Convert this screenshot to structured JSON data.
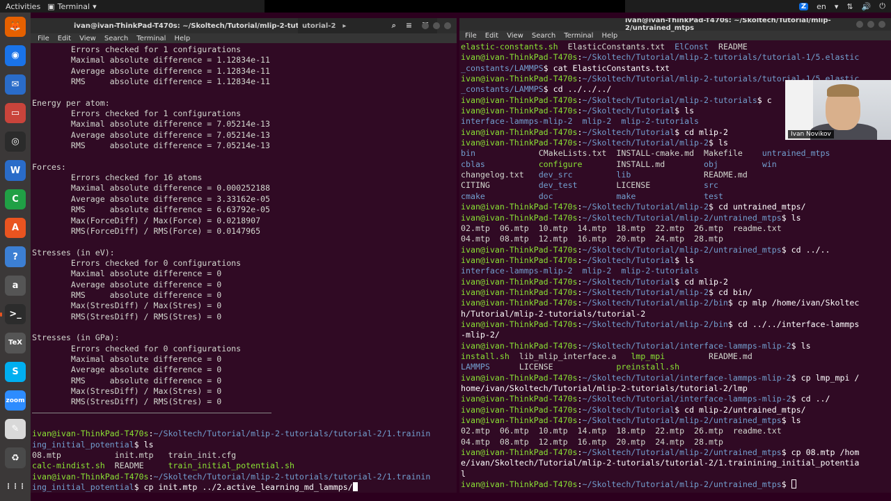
{
  "topbar": {
    "activities": "Activities",
    "app_name": "Terminal",
    "app_menu_arrow": "▾",
    "zoom_badge": "Z",
    "language": "en",
    "indicators": [
      "▾",
      "⇅",
      "🔊",
      "⏻"
    ]
  },
  "dock": {
    "items": [
      {
        "name": "firefox-icon",
        "glyph": "🦊",
        "color": "#e66000"
      },
      {
        "name": "chrome-icon",
        "glyph": "◉",
        "color": "#1a73e8"
      },
      {
        "name": "thunderbird-icon",
        "glyph": "✉",
        "color": "#2a6cc9"
      },
      {
        "name": "files-icon",
        "glyph": "▭",
        "color": "#c9443b"
      },
      {
        "name": "rhythmbox-icon",
        "glyph": "◎",
        "color": "#2b2b2b"
      },
      {
        "name": "writer-icon",
        "glyph": "W",
        "color": "#2a6cc9"
      },
      {
        "name": "calc-icon",
        "glyph": "C",
        "color": "#20a045"
      },
      {
        "name": "software-icon",
        "glyph": "A",
        "color": "#e95420"
      },
      {
        "name": "help-icon",
        "glyph": "?",
        "color": "#3c7fd3"
      },
      {
        "name": "amazon-icon",
        "glyph": "a",
        "color": "#555555"
      },
      {
        "name": "terminal-icon",
        "glyph": ">_",
        "color": "#2c2c2c"
      },
      {
        "name": "texmaker-icon",
        "glyph": "TeX",
        "color": "#555555"
      },
      {
        "name": "skype-icon",
        "glyph": "S",
        "color": "#00aff0"
      },
      {
        "name": "zoom-icon",
        "glyph": "zoom",
        "color": "#2d8cff"
      },
      {
        "name": "text-editor-icon",
        "glyph": "✎",
        "color": "#d9d9d9"
      },
      {
        "name": "trash-icon",
        "glyph": "♻",
        "color": "#4a4a4a"
      },
      {
        "name": "show-apps-icon",
        "glyph": "⋮⋮⋮",
        "color": "#3b3838"
      }
    ]
  },
  "left_window": {
    "title": "ivan@ivan-ThinkPad-T470s: ~/Skoltech/Tutorial/mlip-2-tut",
    "tab_fragment": "utorial-2",
    "menu": [
      "File",
      "Edit",
      "View",
      "Search",
      "Terminal",
      "Help"
    ],
    "lines": [
      [
        [
          "c-o",
          "        Errors checked for 1 configurations"
        ]
      ],
      [
        [
          "c-o",
          "        Maximal absolute difference = 1.12834e-11"
        ]
      ],
      [
        [
          "c-o",
          "        Average absolute difference = 1.12834e-11"
        ]
      ],
      [
        [
          "c-o",
          "        RMS     absolute difference = 1.12834e-11"
        ]
      ],
      [
        [
          "c-o",
          ""
        ]
      ],
      [
        [
          "c-o",
          "Energy per atom:"
        ]
      ],
      [
        [
          "c-o",
          "        Errors checked for 1 configurations"
        ]
      ],
      [
        [
          "c-o",
          "        Maximal absolute difference = 7.05214e-13"
        ]
      ],
      [
        [
          "c-o",
          "        Average absolute difference = 7.05214e-13"
        ]
      ],
      [
        [
          "c-o",
          "        RMS     absolute difference = 7.05214e-13"
        ]
      ],
      [
        [
          "c-o",
          ""
        ]
      ],
      [
        [
          "c-o",
          "Forces:"
        ]
      ],
      [
        [
          "c-o",
          "        Errors checked for 16 atoms"
        ]
      ],
      [
        [
          "c-o",
          "        Maximal absolute difference = 0.000252188"
        ]
      ],
      [
        [
          "c-o",
          "        Average absolute difference = 3.33162e-05"
        ]
      ],
      [
        [
          "c-o",
          "        RMS     absolute difference = 6.63792e-05"
        ]
      ],
      [
        [
          "c-o",
          "        Max(ForceDiff) / Max(Force) = 0.0218907"
        ]
      ],
      [
        [
          "c-o",
          "        RMS(ForceDiff) / RMS(Force) = 0.0147965"
        ]
      ],
      [
        [
          "c-o",
          ""
        ]
      ],
      [
        [
          "c-o",
          "Stresses (in eV):"
        ]
      ],
      [
        [
          "c-o",
          "        Errors checked for 0 configurations"
        ]
      ],
      [
        [
          "c-o",
          "        Maximal absolute difference = 0"
        ]
      ],
      [
        [
          "c-o",
          "        Average absolute difference = 0"
        ]
      ],
      [
        [
          "c-o",
          "        RMS     absolute difference = 0"
        ]
      ],
      [
        [
          "c-o",
          "        Max(StresDiff) / Max(Stres) = 0"
        ]
      ],
      [
        [
          "c-o",
          "        RMS(StresDiff) / RMS(Stres) = 0"
        ]
      ],
      [
        [
          "c-o",
          ""
        ]
      ],
      [
        [
          "c-o",
          "Stresses (in GPa):"
        ]
      ],
      [
        [
          "c-o",
          "        Errors checked for 0 configurations"
        ]
      ],
      [
        [
          "c-o",
          "        Maximal absolute difference = 0"
        ]
      ],
      [
        [
          "c-o",
          "        Average absolute difference = 0"
        ]
      ],
      [
        [
          "c-o",
          "        RMS     absolute difference = 0"
        ]
      ],
      [
        [
          "c-o",
          "        Max(StresDiff) / Max(Stres) = 0"
        ]
      ],
      [
        [
          "c-o",
          "        RMS(StresDiff) / RMS(Stres) = 0"
        ]
      ],
      [
        [
          "c-o",
          ""
        ]
      ],
      [
        [
          "c-o",
          ""
        ]
      ],
      [
        [
          "c-g",
          "ivan@ivan-ThinkPad-T470s"
        ],
        [
          "c-w",
          ":"
        ],
        [
          "c-b",
          "~/Skoltech/Tutorial/mlip-2-tutorials/tutorial-2/1.trainin"
        ]
      ],
      [
        [
          "c-b",
          "ing_initial_potential"
        ],
        [
          "c-w",
          "$ ls"
        ]
      ],
      [
        [
          "c-o",
          "08.mtp           init.mtp   train_init.cfg"
        ]
      ],
      [
        [
          "c-g",
          "calc-mindist.sh"
        ],
        [
          "c-o",
          "  README     "
        ],
        [
          "c-g",
          "train_initial_potential.sh"
        ]
      ],
      [
        [
          "c-g",
          "ivan@ivan-ThinkPad-T470s"
        ],
        [
          "c-w",
          ":"
        ],
        [
          "c-b",
          "~/Skoltech/Tutorial/mlip-2-tutorials/tutorial-2/1.trainin"
        ]
      ],
      [
        [
          "c-b",
          "ing_initial_potential"
        ],
        [
          "c-w",
          "$ cp init.mtp ../2.active_learning_md_lammps/"
        ],
        [
          "cursor",
          ""
        ]
      ]
    ]
  },
  "right_window": {
    "title": "ivan@ivan-ThinkPad-T470s: ~/Skoltech/Tutorial/mlip-2/untrained_mtps",
    "menu": [
      "File",
      "Edit",
      "View",
      "Search",
      "Terminal",
      "Help"
    ],
    "lines": [
      [
        [
          "c-g",
          "elastic-constants.sh"
        ],
        [
          "c-o",
          "  ElasticConstants.txt  "
        ],
        [
          "c-b",
          "ElConst"
        ],
        [
          "c-o",
          "  README"
        ]
      ],
      [
        [
          "c-g",
          "ivan@ivan-ThinkPad-T470s"
        ],
        [
          "c-w",
          ":"
        ],
        [
          "c-b",
          "~/Skoltech/Tutorial/mlip-2-tutorials/tutorial-1/5.elastic"
        ]
      ],
      [
        [
          "c-b",
          "_constants/LAMMPS"
        ],
        [
          "c-w",
          "$ cat ElasticConstants.txt"
        ]
      ],
      [
        [
          "c-g",
          "ivan@ivan-ThinkPad-T470s"
        ],
        [
          "c-w",
          ":"
        ],
        [
          "c-b",
          "~/Skoltech/Tutorial/mlip-2-tutorials/tutorial-1/5.elastic"
        ]
      ],
      [
        [
          "c-b",
          "_constants/LAMMPS"
        ],
        [
          "c-w",
          "$ cd ../../../"
        ]
      ],
      [
        [
          "c-g",
          "ivan@ivan-ThinkPad-T470s"
        ],
        [
          "c-w",
          ":"
        ],
        [
          "c-b",
          "~/Skoltech/Tutorial/mlip-2-tutorials"
        ],
        [
          "c-w",
          "$ c"
        ]
      ],
      [
        [
          "c-g",
          "ivan@ivan-ThinkPad-T470s"
        ],
        [
          "c-w",
          ":"
        ],
        [
          "c-b",
          "~/Skoltech/Tutorial"
        ],
        [
          "c-w",
          "$ ls"
        ]
      ],
      [
        [
          "c-b",
          "interface-lammps-mlip-2  mlip-2  mlip-2-tutorials"
        ]
      ],
      [
        [
          "c-g",
          "ivan@ivan-ThinkPad-T470s"
        ],
        [
          "c-w",
          ":"
        ],
        [
          "c-b",
          "~/Skoltech/Tutorial"
        ],
        [
          "c-w",
          "$ cd mlip-2"
        ]
      ],
      [
        [
          "c-g",
          "ivan@ivan-ThinkPad-T470s"
        ],
        [
          "c-w",
          ":"
        ],
        [
          "c-b",
          "~/Skoltech/Tutorial/mlip-2"
        ],
        [
          "c-w",
          "$ ls"
        ]
      ],
      [
        [
          "c-b",
          "bin"
        ],
        [
          "c-o",
          "             CMakeLists.txt  INSTALL-cmake.md  Makefile    "
        ],
        [
          "c-b",
          "untrained_mtps"
        ]
      ],
      [
        [
          "c-b",
          "cblas"
        ],
        [
          "c-o",
          "           "
        ],
        [
          "c-g",
          "configure"
        ],
        [
          "c-o",
          "       INSTALL.md        "
        ],
        [
          "c-b",
          "obj"
        ],
        [
          "c-o",
          "         "
        ],
        [
          "c-b",
          "win"
        ]
      ],
      [
        [
          "c-o",
          "changelog.txt   "
        ],
        [
          "c-b",
          "dev_src"
        ],
        [
          "c-o",
          "         "
        ],
        [
          "c-b",
          "lib"
        ],
        [
          "c-o",
          "               README.md"
        ]
      ],
      [
        [
          "c-o",
          "CITING          "
        ],
        [
          "c-b",
          "dev_test"
        ],
        [
          "c-o",
          "        LICENSE           "
        ],
        [
          "c-b",
          "src"
        ]
      ],
      [
        [
          "c-b",
          "cmake"
        ],
        [
          "c-o",
          "           "
        ],
        [
          "c-b",
          "doc"
        ],
        [
          "c-o",
          "             "
        ],
        [
          "c-b",
          "make"
        ],
        [
          "c-o",
          "              "
        ],
        [
          "c-b",
          "test"
        ]
      ],
      [
        [
          "c-g",
          "ivan@ivan-ThinkPad-T470s"
        ],
        [
          "c-w",
          ":"
        ],
        [
          "c-b",
          "~/Skoltech/Tutorial/mlip-2"
        ],
        [
          "c-w",
          "$ cd untrained_mtps/"
        ]
      ],
      [
        [
          "c-g",
          "ivan@ivan-ThinkPad-T470s"
        ],
        [
          "c-w",
          ":"
        ],
        [
          "c-b",
          "~/Skoltech/Tutorial/mlip-2/untrained_mtps"
        ],
        [
          "c-w",
          "$ ls"
        ]
      ],
      [
        [
          "c-o",
          "02.mtp  06.mtp  10.mtp  14.mtp  18.mtp  22.mtp  26.mtp  readme.txt"
        ]
      ],
      [
        [
          "c-o",
          "04.mtp  08.mtp  12.mtp  16.mtp  20.mtp  24.mtp  28.mtp"
        ]
      ],
      [
        [
          "c-g",
          "ivan@ivan-ThinkPad-T470s"
        ],
        [
          "c-w",
          ":"
        ],
        [
          "c-b",
          "~/Skoltech/Tutorial/mlip-2/untrained_mtps"
        ],
        [
          "c-w",
          "$ cd ../.."
        ]
      ],
      [
        [
          "c-g",
          "ivan@ivan-ThinkPad-T470s"
        ],
        [
          "c-w",
          ":"
        ],
        [
          "c-b",
          "~/Skoltech/Tutorial"
        ],
        [
          "c-w",
          "$ ls"
        ]
      ],
      [
        [
          "c-b",
          "interface-lammps-mlip-2  mlip-2  mlip-2-tutorials"
        ]
      ],
      [
        [
          "c-g",
          "ivan@ivan-ThinkPad-T470s"
        ],
        [
          "c-w",
          ":"
        ],
        [
          "c-b",
          "~/Skoltech/Tutorial"
        ],
        [
          "c-w",
          "$ cd mlip-2"
        ]
      ],
      [
        [
          "c-g",
          "ivan@ivan-ThinkPad-T470s"
        ],
        [
          "c-w",
          ":"
        ],
        [
          "c-b",
          "~/Skoltech/Tutorial/mlip-2"
        ],
        [
          "c-w",
          "$ cd bin/"
        ]
      ],
      [
        [
          "c-g",
          "ivan@ivan-ThinkPad-T470s"
        ],
        [
          "c-w",
          ":"
        ],
        [
          "c-b",
          "~/Skoltech/Tutorial/mlip-2/bin"
        ],
        [
          "c-w",
          "$ cp mlp /home/ivan/Skoltec"
        ]
      ],
      [
        [
          "c-w",
          "h/Tutorial/mlip-2-tutorials/tutorial-2"
        ]
      ],
      [
        [
          "c-g",
          "ivan@ivan-ThinkPad-T470s"
        ],
        [
          "c-w",
          ":"
        ],
        [
          "c-b",
          "~/Skoltech/Tutorial/mlip-2/bin"
        ],
        [
          "c-w",
          "$ cd ../../interface-lammps"
        ]
      ],
      [
        [
          "c-w",
          "-mlip-2/"
        ]
      ],
      [
        [
          "c-g",
          "ivan@ivan-ThinkPad-T470s"
        ],
        [
          "c-w",
          ":"
        ],
        [
          "c-b",
          "~/Skoltech/Tutorial/interface-lammps-mlip-2"
        ],
        [
          "c-w",
          "$ ls"
        ]
      ],
      [
        [
          "c-g",
          "install.sh"
        ],
        [
          "c-o",
          "  lib_mlip_interface.a   "
        ],
        [
          "c-g",
          "lmp_mpi"
        ],
        [
          "c-o",
          "         README.md"
        ]
      ],
      [
        [
          "c-b",
          "LAMMPS"
        ],
        [
          "c-o",
          "      LICENSE             "
        ],
        [
          "c-g",
          "preinstall.sh"
        ]
      ],
      [
        [
          "c-g",
          "ivan@ivan-ThinkPad-T470s"
        ],
        [
          "c-w",
          ":"
        ],
        [
          "c-b",
          "~/Skoltech/Tutorial/interface-lammps-mlip-2"
        ],
        [
          "c-w",
          "$ cp lmp_mpi /"
        ]
      ],
      [
        [
          "c-w",
          "home/ivan/Skoltech/Tutorial/mlip-2-tutorials/tutorial-2/lmp"
        ]
      ],
      [
        [
          "c-g",
          "ivan@ivan-ThinkPad-T470s"
        ],
        [
          "c-w",
          ":"
        ],
        [
          "c-b",
          "~/Skoltech/Tutorial/interface-lammps-mlip-2"
        ],
        [
          "c-w",
          "$ cd ../"
        ]
      ],
      [
        [
          "c-g",
          "ivan@ivan-ThinkPad-T470s"
        ],
        [
          "c-w",
          ":"
        ],
        [
          "c-b",
          "~/Skoltech/Tutorial"
        ],
        [
          "c-w",
          "$ cd mlip-2/untrained_mtps/"
        ]
      ],
      [
        [
          "c-g",
          "ivan@ivan-ThinkPad-T470s"
        ],
        [
          "c-w",
          ":"
        ],
        [
          "c-b",
          "~/Skoltech/Tutorial/mlip-2/untrained_mtps"
        ],
        [
          "c-w",
          "$ ls"
        ]
      ],
      [
        [
          "c-o",
          "02.mtp  06.mtp  10.mtp  14.mtp  18.mtp  22.mtp  26.mtp  readme.txt"
        ]
      ],
      [
        [
          "c-o",
          "04.mtp  08.mtp  12.mtp  16.mtp  20.mtp  24.mtp  28.mtp"
        ]
      ],
      [
        [
          "c-g",
          "ivan@ivan-ThinkPad-T470s"
        ],
        [
          "c-w",
          ":"
        ],
        [
          "c-b",
          "~/Skoltech/Tutorial/mlip-2/untrained_mtps"
        ],
        [
          "c-w",
          "$ cp 08.mtp /hom"
        ]
      ],
      [
        [
          "c-w",
          "e/ivan/Skoltech/Tutorial/mlip-2-tutorials/tutorial-2/1.trainining_initial_potentia"
        ]
      ],
      [
        [
          "c-w",
          "l"
        ]
      ],
      [
        [
          "c-g",
          "ivan@ivan-ThinkPad-T470s"
        ],
        [
          "c-w",
          ":"
        ],
        [
          "c-b",
          "~/Skoltech/Tutorial/mlip-2/untrained_mtps"
        ],
        [
          "c-w",
          "$ "
        ],
        [
          "cursor-hollow",
          ""
        ]
      ]
    ]
  },
  "webcam": {
    "name": "Ivan Novikov"
  }
}
